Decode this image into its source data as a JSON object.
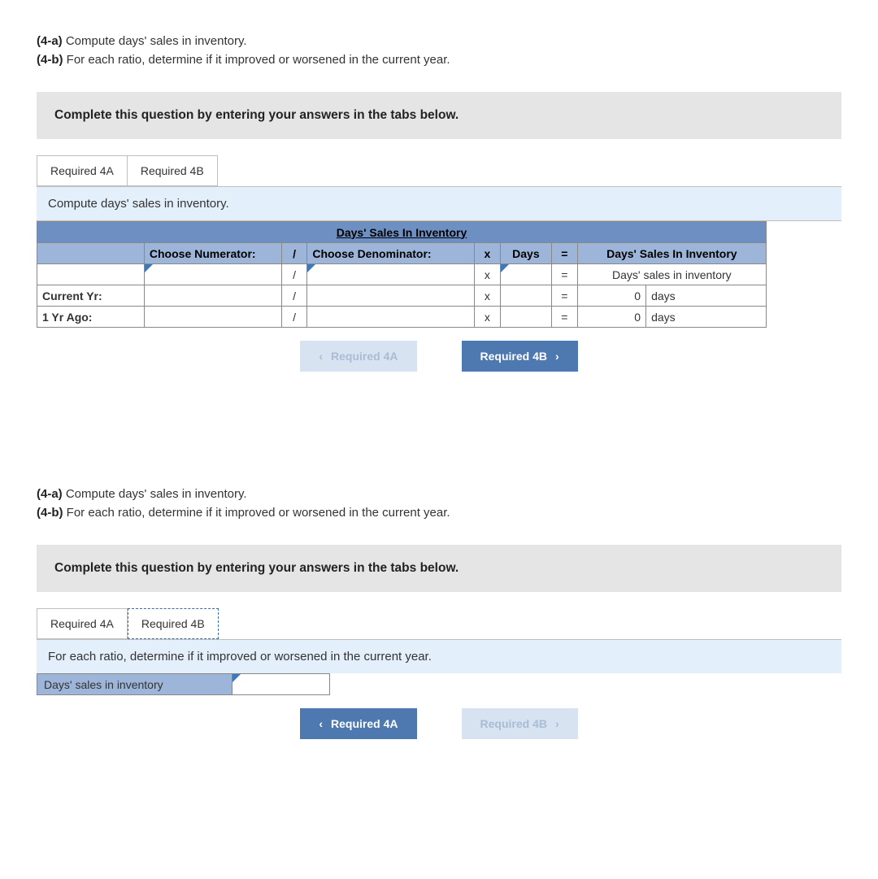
{
  "prompt": {
    "a_tag": "(4-a)",
    "a_text": "Compute days' sales in inventory.",
    "b_tag": "(4-b)",
    "b_text": "For each ratio, determine if it improved or worsened in the current year."
  },
  "instruct": "Complete this question by entering your answers in the tabs below.",
  "tabs": {
    "a": "Required 4A",
    "b": "Required 4B"
  },
  "panel4a": {
    "sub": "Compute days' sales in inventory.",
    "title": "Days' Sales In Inventory",
    "hdr": {
      "numer": "Choose Numerator:",
      "slash": "/",
      "denom": "Choose Denominator:",
      "x": "x",
      "days": "Days",
      "eq": "=",
      "result": "Days' Sales In Inventory"
    },
    "rows": [
      {
        "label": "",
        "slash": "/",
        "x": "x",
        "eq": "=",
        "result": "Days' sales in inventory",
        "val": "",
        "unit": ""
      },
      {
        "label": "Current Yr:",
        "slash": "/",
        "x": "x",
        "eq": "=",
        "val": "0",
        "unit": "days"
      },
      {
        "label": "1 Yr Ago:",
        "slash": "/",
        "x": "x",
        "eq": "=",
        "val": "0",
        "unit": "days"
      }
    ],
    "nav": {
      "prev": "Required 4A",
      "next": "Required 4B"
    }
  },
  "panel4b": {
    "sub": "For each ratio, determine if it improved or worsened in the current year.",
    "rowlabel": "Days' sales in inventory",
    "nav": {
      "prev": "Required 4A",
      "next": "Required 4B"
    }
  }
}
